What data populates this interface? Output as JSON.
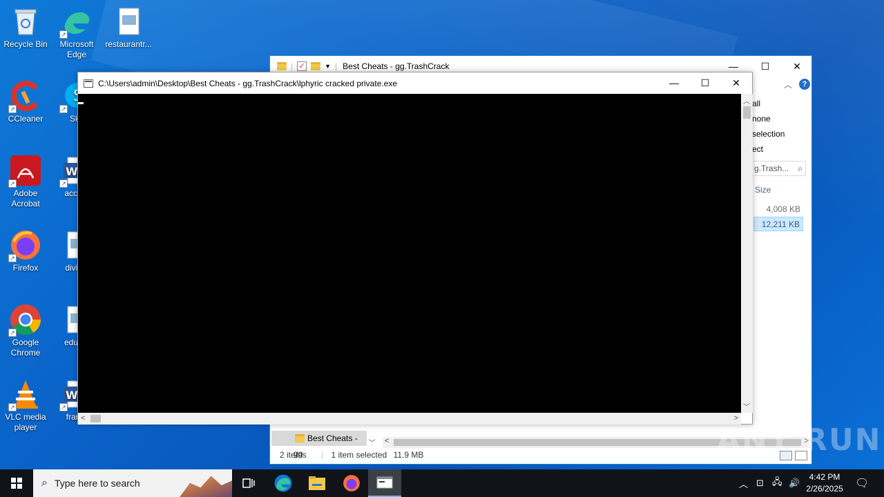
{
  "desktop": {
    "icons": [
      {
        "label": "Recycle Bin",
        "icon": "recycle-bin-icon"
      },
      {
        "label": "Microsoft Edge",
        "icon": "edge-icon"
      },
      {
        "label": "restaurantr...",
        "icon": "image-file-icon"
      },
      {
        "label": "CCleaner",
        "icon": "ccleaner-icon"
      },
      {
        "label": "Sky",
        "icon": "skype-icon"
      },
      {
        "label": "Adobe Acrobat",
        "icon": "acrobat-icon"
      },
      {
        "label": "accept",
        "icon": "word-doc-icon"
      },
      {
        "label": "Firefox",
        "icon": "firefox-icon"
      },
      {
        "label": "divisio",
        "icon": "image-file-icon"
      },
      {
        "label": "Google Chrome",
        "icon": "chrome-icon"
      },
      {
        "label": "educat",
        "icon": "image-file-icon"
      },
      {
        "label": "VLC media player",
        "icon": "vlc-icon"
      },
      {
        "label": "frame",
        "icon": "word-doc-icon"
      }
    ]
  },
  "explorer": {
    "title": "Best Cheats - gg.TrashCrack",
    "ribbon_select": [
      "all",
      "none",
      "selection",
      "ect"
    ],
    "search_text": "g.Trash...",
    "column_size": "Size",
    "sizes": [
      "4,008 KB",
      "12,211 KB"
    ],
    "nav_item": "Best Cheats - gg",
    "status": {
      "items": "2 items",
      "selected": "1 item selected",
      "selected_size": "11.9 MB"
    }
  },
  "console": {
    "title": "C:\\Users\\admin\\Desktop\\Best Cheats - gg.TrashCrack\\lphyric cracked private.exe"
  },
  "watermark": "ANY RUN",
  "taskbar": {
    "search_placeholder": "Type here to search",
    "time": "4:42 PM",
    "date": "2/26/2025"
  }
}
